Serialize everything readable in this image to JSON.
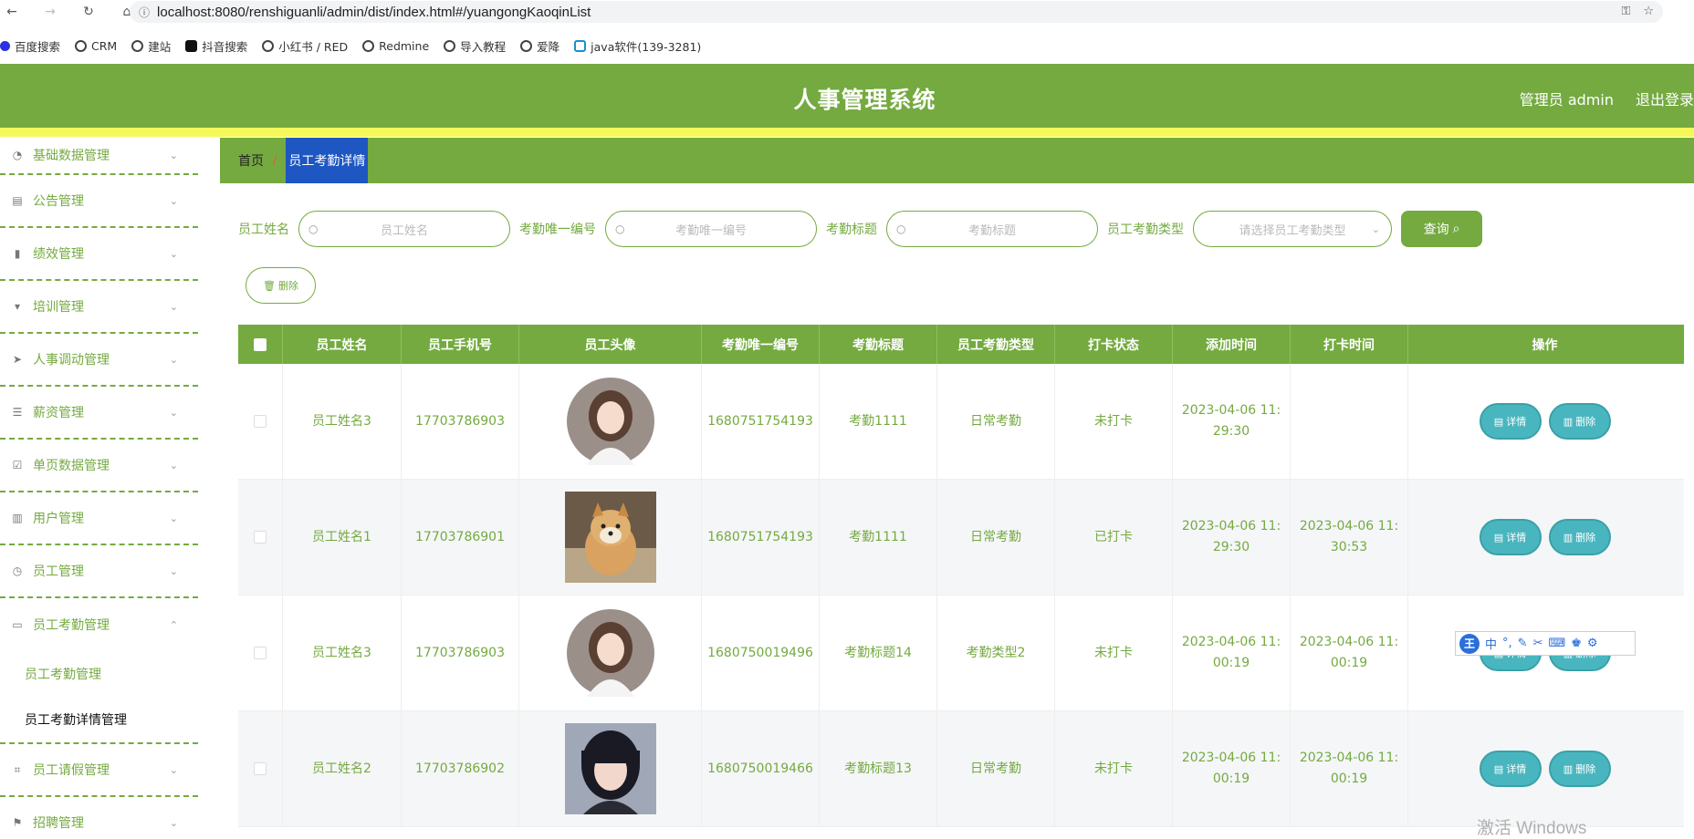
{
  "browser": {
    "url": "localhost:8080/renshiguanli/admin/dist/index.html#/yuangongKaoqinList",
    "bookmarks": [
      "百度搜索",
      "CRM",
      "建站",
      "抖音搜索",
      "小红书 / RED",
      "Redmine",
      "导入教程",
      "爱降",
      "java软件(139-3281)"
    ]
  },
  "header": {
    "title": "人事管理系统",
    "user": "管理员 admin",
    "logout": "退出登录"
  },
  "sidebar": {
    "items": [
      {
        "label": "基础数据管理",
        "icon": "dashboard-icon"
      },
      {
        "label": "公告管理",
        "icon": "clipboard-icon"
      },
      {
        "label": "绩效管理",
        "icon": "book-icon"
      },
      {
        "label": "培训管理",
        "icon": "brush-icon"
      },
      {
        "label": "人事调动管理",
        "icon": "send-icon"
      },
      {
        "label": "薪资管理",
        "icon": "list-icon"
      },
      {
        "label": "单页数据管理",
        "icon": "checklist-icon"
      },
      {
        "label": "用户管理",
        "icon": "bar-chart-icon"
      },
      {
        "label": "员工管理",
        "icon": "clock-icon"
      },
      {
        "label": "员工考勤管理",
        "icon": "message-icon"
      }
    ],
    "submenu": [
      "员工考勤管理",
      "员工考勤详情管理"
    ],
    "after": [
      {
        "label": "员工请假管理",
        "icon": "crop-icon"
      },
      {
        "label": "招聘管理",
        "icon": "flag-icon"
      }
    ]
  },
  "breadcrumb": {
    "home": "首页",
    "sep": "/",
    "current": "员工考勤详情"
  },
  "search": {
    "name_label": "员工姓名",
    "name_placeholder": "员工姓名",
    "uid_label": "考勤唯一编号",
    "uid_placeholder": "考勤唯一编号",
    "title_label": "考勤标题",
    "title_placeholder": "考勤标题",
    "type_label": "员工考勤类型",
    "type_placeholder": "请选择员工考勤类型",
    "query": "查询"
  },
  "delete_label": "删除",
  "table": {
    "headers": [
      "员工姓名",
      "员工手机号",
      "员工头像",
      "考勤唯一编号",
      "考勤标题",
      "员工考勤类型",
      "打卡状态",
      "添加时间",
      "打卡时间",
      "操作"
    ],
    "rows": [
      {
        "name": "员工姓名3",
        "phone": "17703786903",
        "avatar": "girl-illustration",
        "uid": "1680751754193",
        "title": "考勤1111",
        "type": "日常考勤",
        "status": "未打卡",
        "added1": "2023-04-06 11:",
        "added2": "29:30",
        "punch1": "",
        "punch2": ""
      },
      {
        "name": "员工姓名1",
        "phone": "17703786901",
        "avatar": "shiba-dog-photo",
        "uid": "1680751754193",
        "title": "考勤1111",
        "type": "日常考勤",
        "status": "已打卡",
        "added1": "2023-04-06 11:",
        "added2": "29:30",
        "punch1": "2023-04-06 11:",
        "punch2": "30:53"
      },
      {
        "name": "员工姓名3",
        "phone": "17703786903",
        "avatar": "girl-illustration",
        "uid": "1680750019496",
        "title": "考勤标题14",
        "type": "考勤类型2",
        "status": "未打卡",
        "added1": "2023-04-06 11:",
        "added2": "00:19",
        "punch1": "2023-04-06 11:",
        "punch2": "00:19"
      },
      {
        "name": "员工姓名2",
        "phone": "17703786902",
        "avatar": "girl-photo",
        "uid": "1680750019466",
        "title": "考勤标题13",
        "type": "日常考勤",
        "status": "未打卡",
        "added1": "2023-04-06 11:",
        "added2": "00:19",
        "punch1": "2023-04-06 11:",
        "punch2": "00:19"
      }
    ],
    "detail": "详情",
    "delete": "删除"
  },
  "ime": {
    "logo": "王",
    "lang": "中"
  },
  "watermark": "激活 Windows",
  "colors": {
    "primary": "#74aa40",
    "accent_yellow": "#f4f85a",
    "button_teal": "#49b6bf",
    "breadcrumb_active": "#1e56c2"
  }
}
